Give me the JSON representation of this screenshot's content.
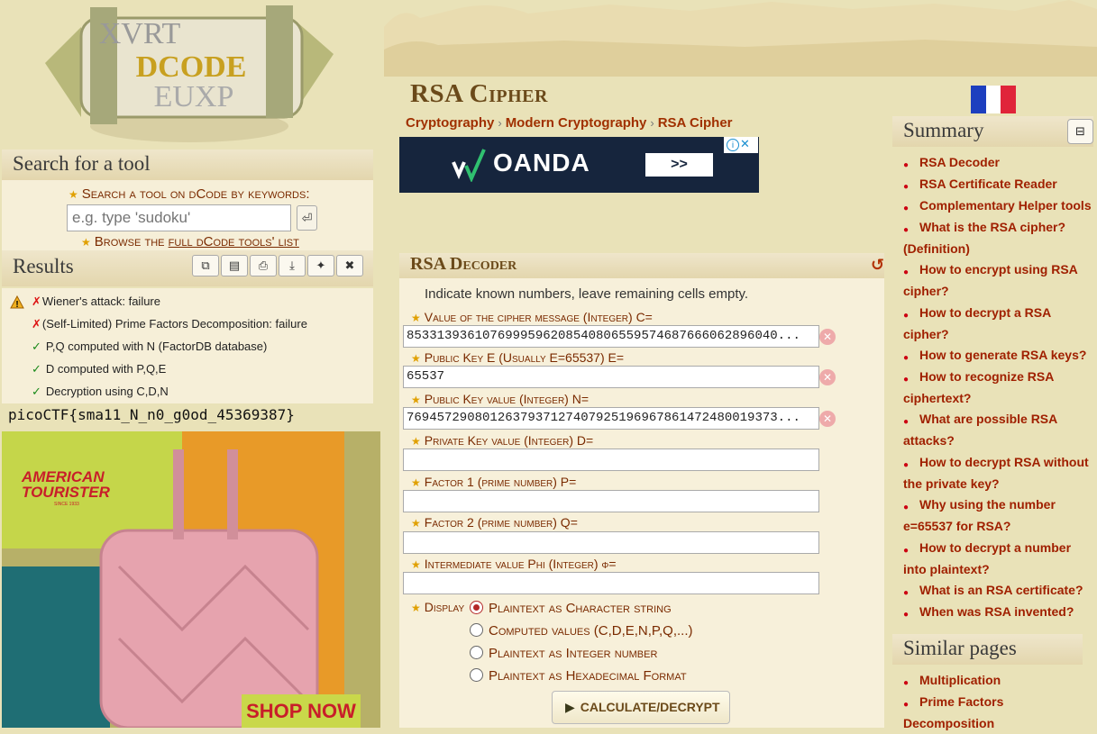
{
  "search": {
    "title": "Search for a tool",
    "keyword_label": "Search a tool on dCode by keywords:",
    "placeholder": "e.g. type 'sudoku'",
    "browse_prefix": "Browse the ",
    "browse_link": "full dCode tools' list",
    "go_icon": "⏎"
  },
  "results": {
    "title": "Results",
    "toolbar": [
      "copy-icon",
      "clipboard-icon",
      "print-icon",
      "download-icon",
      "pin-icon",
      "close-icon"
    ],
    "lines": [
      {
        "mark": "✗",
        "text": "Wiener's attack: failure"
      },
      {
        "mark": "✗",
        "text": "(Self-Limited) Prime Factors Decomposition: failure"
      },
      {
        "mark": "✓",
        "text": "P,Q computed with N (FactorDB database)"
      },
      {
        "mark": "✓",
        "text": "D computed with P,Q,E"
      },
      {
        "mark": "✓",
        "text": "Decryption using C,D,N"
      }
    ],
    "output": "picoCTF{sma11_N_n0_g0od_45369387}"
  },
  "logo": {
    "letters_top": "XVRT",
    "letters_mid": "DCODE",
    "letters_bot": "EUXP"
  },
  "ad_left": {
    "brand": "AMERICAN TOURISTER",
    "since": "SINCE 1933",
    "cta": "SHOP NOW"
  },
  "ad_top": {
    "brand": "OANDA",
    "cta": ">>"
  },
  "page": {
    "title": "RSA Cipher",
    "breadcrumb": [
      "Cryptography",
      "Modern Cryptography",
      "RSA Cipher"
    ]
  },
  "decoder": {
    "title": "RSA Decoder",
    "intro": "Indicate known numbers, leave remaining cells empty.",
    "fields": [
      {
        "label": "Value of the cipher message (Integer) C=",
        "value": "8533139361076999596208540806559574687666062896040..."
      },
      {
        "label": "Public Key E (Usually E=65537) E=",
        "value": "65537"
      },
      {
        "label": "Public Key value (Integer) N=",
        "value": "7694572908012637937127407925196967861472480019373..."
      },
      {
        "label": "Private Key value (Integer) D=",
        "value": ""
      },
      {
        "label": "Factor 1 (prime number) P=",
        "value": ""
      },
      {
        "label": "Factor 2 (prime number) Q=",
        "value": ""
      },
      {
        "label": "Intermediate value Phi (Integer) φ=",
        "value": ""
      }
    ],
    "display_label": "Display",
    "display_options": [
      {
        "label": "Plaintext as Character string",
        "selected": true
      },
      {
        "label": "Computed values (C,D,E,N,P,Q,...)",
        "selected": false
      },
      {
        "label": "Plaintext as Integer number",
        "selected": false
      },
      {
        "label": "Plaintext as Hexadecimal Format",
        "selected": false
      }
    ],
    "calculate_label": "CALCULATE/DECRYPT"
  },
  "summary": {
    "title": "Summary",
    "links": [
      "RSA Decoder",
      "RSA Certificate Reader",
      "Complementary Helper tools",
      "What is the RSA cipher? (Definition)",
      "How to encrypt using RSA cipher?",
      "How to decrypt a RSA cipher?",
      "How to generate RSA keys?",
      "How to recognize RSA ciphertext?",
      "What are possible RSA attacks?",
      "How to decrypt RSA without the private key?",
      "Why using the number e=65537 for RSA?",
      "How to decrypt a number into plaintext?",
      "What is an RSA certificate?",
      "When was RSA invented?"
    ]
  },
  "similar": {
    "title": "Similar pages",
    "links": [
      "Multiplication",
      "Prime Factors Decomposition"
    ]
  },
  "colors": {
    "accent": "#a02000",
    "label": "#7a2a00",
    "title": "#6b4a1a",
    "background": "#e9e2b8"
  }
}
